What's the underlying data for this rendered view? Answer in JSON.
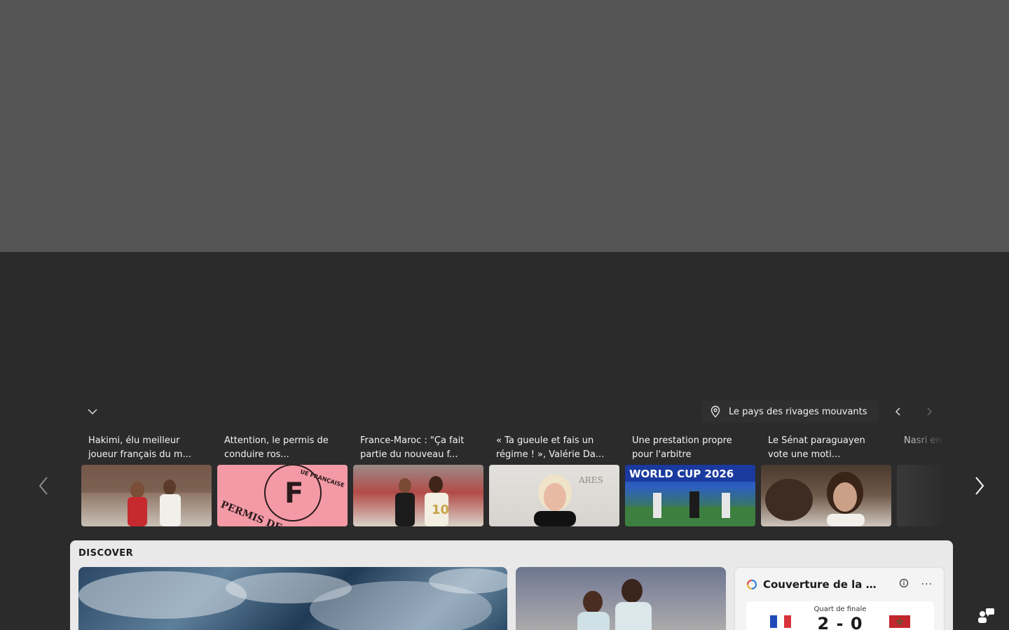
{
  "colors": {
    "overlay": "#555555",
    "background": "#2b2b2b",
    "discover_bg": "#e9e9e9"
  },
  "header": {
    "collapse_icon": "chevron-down-icon",
    "location": {
      "icon": "location-pin-icon",
      "label": "Le pays des rivages mouvants"
    },
    "prev_icon": "chevron-left-icon",
    "next_icon": "chevron-right-icon"
  },
  "carousel": {
    "prev_icon": "chevron-left-icon",
    "next_icon": "chevron-right-icon",
    "cards": [
      {
        "caption": "Hakimi, élu meilleur joueur français du m..."
      },
      {
        "caption": "Attention, le permis de conduire ros..."
      },
      {
        "caption": "France-Maroc : \"Ça fait partie du nouveau f..."
      },
      {
        "caption": "« Ta gueule et fais un régime ! », Valérie Da..."
      },
      {
        "caption": "Une prestation propre pour l'arbitre"
      },
      {
        "caption": "Le Sénat paraguayen vote une moti..."
      },
      {
        "caption": "Nasri en pour une"
      }
    ],
    "thumb_text": {
      "permis": "PERMIS DE C",
      "permis_letter": "F",
      "permis_banner": "UE FRANÇAISE",
      "worldcup": "WORLD CUP 2026",
      "jersey": "10",
      "trophees": "ARES"
    }
  },
  "discover": {
    "label": "DISCOVER",
    "score_tile": {
      "title": "Couverture de la Co...",
      "info_icon": "info-icon",
      "more_label": "···",
      "stage": "Quart de finale",
      "score": "2 - 0"
    }
  },
  "feedback_icon": "feedback-icon"
}
